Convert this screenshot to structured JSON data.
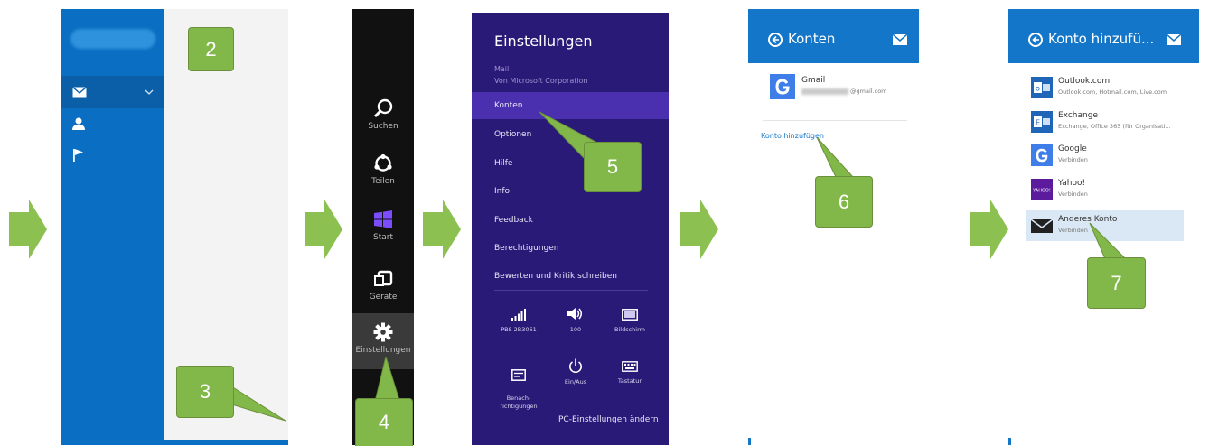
{
  "callouts": {
    "c2": "2",
    "c3": "3",
    "c4": "4",
    "c5": "5",
    "c6": "6",
    "c7": "7"
  },
  "charms": [
    {
      "label": "Suchen",
      "icon": "search-icon"
    },
    {
      "label": "Teilen",
      "icon": "share-icon"
    },
    {
      "label": "Start",
      "icon": "windows-icon"
    },
    {
      "label": "Geräte",
      "icon": "devices-icon"
    },
    {
      "label": "Einstellungen",
      "icon": "gear-icon"
    }
  ],
  "settings": {
    "title": "Einstellungen",
    "app": "Mail",
    "publisher": "Von Microsoft Corporation",
    "items": [
      "Konten",
      "Optionen",
      "Hilfe",
      "Info",
      "Feedback",
      "Berechtigungen",
      "Bewerten und Kritik schreiben"
    ],
    "tiles": [
      {
        "label": "PBS 2B3061",
        "icon": "network-icon"
      },
      {
        "label": "100",
        "icon": "volume-icon"
      },
      {
        "label": "Bildschirm",
        "icon": "screen-icon"
      },
      {
        "label": "Benach-\nrichtigungen",
        "icon": "notifications-icon"
      },
      {
        "label": "Ein/Aus",
        "icon": "power-icon"
      },
      {
        "label": "Tastatur",
        "icon": "keyboard-icon"
      }
    ],
    "pc_settings": "PC-Einstellungen ändern"
  },
  "konten": {
    "title": "Konten",
    "account_name": "Gmail",
    "account_email": "@gmail.com",
    "add_account": "Konto hinzufügen"
  },
  "add_account": {
    "title": "Konto hinzufü...",
    "providers": [
      {
        "name": "Outlook.com",
        "desc": "Outlook.com, Hotmail.com, Live.com"
      },
      {
        "name": "Exchange",
        "desc": "Exchange, Office 365 (für Organisati..."
      },
      {
        "name": "Google",
        "desc": "Verbinden"
      },
      {
        "name": "Yahoo!",
        "desc": "Verbinden",
        "logo_text": "YAHOO!"
      },
      {
        "name": "Anderes Konto",
        "desc": "Verbinden"
      }
    ]
  },
  "colors": {
    "arrow": "#8cc152",
    "mail_blue": "#0a6fc2",
    "settings_purple": "#2a1a78",
    "callout_green": "#82b84a"
  }
}
